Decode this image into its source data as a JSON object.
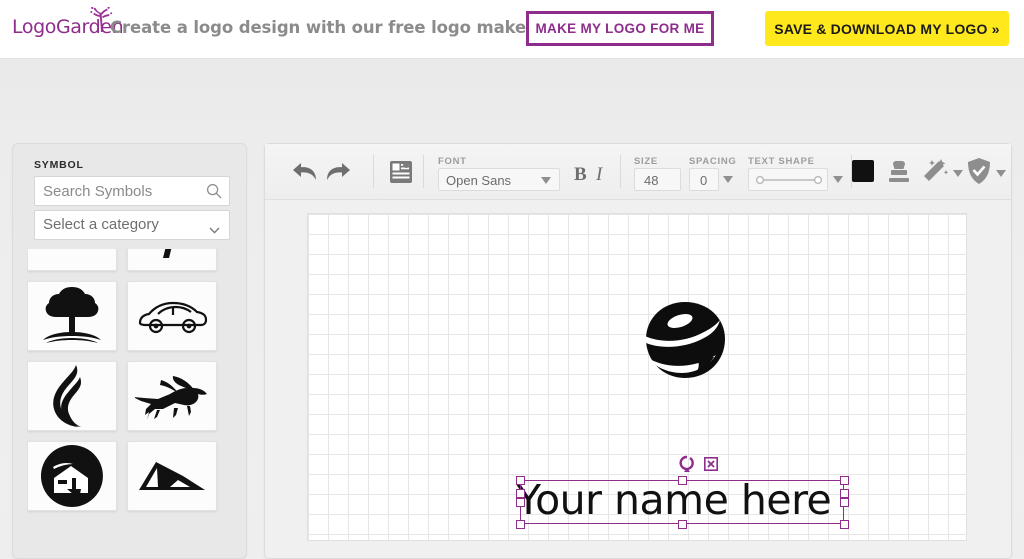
{
  "header": {
    "logo_text_left": "Logo",
    "logo_text_right": "Garden",
    "logo_icon": "plant-sprout-icon",
    "tagline": "Create a logo design with our free logo maker.",
    "make_logo_button": "MAKE MY LOGO FOR ME",
    "save_download_button": "SAVE & DOWNLOAD MY LOGO »",
    "accent_purple": "#8e2d8b",
    "accent_yellow": "#ffe81c"
  },
  "sidebar": {
    "title": "SYMBOL",
    "search": {
      "placeholder": "Search Symbols",
      "value": "",
      "icon": "search-icon"
    },
    "category": {
      "selected": "Select a category",
      "icon": "chevron-down-icon"
    },
    "symbols": [
      {
        "name": "sofa-symbol"
      },
      {
        "name": "lamp-post-symbol"
      },
      {
        "name": "tree-symbol"
      },
      {
        "name": "car-symbol"
      },
      {
        "name": "flame-symbol"
      },
      {
        "name": "pegasus-horse-symbol"
      },
      {
        "name": "house-circle-symbol"
      },
      {
        "name": "mountain-symbol"
      }
    ]
  },
  "toolbar": {
    "undo_label": "undo-icon",
    "redo_label": "redo-icon",
    "add_text_label": "add-text-icon",
    "font": {
      "label": "FONT",
      "value": "Open Sans"
    },
    "bold": {
      "label": "B"
    },
    "italic": {
      "label": "I"
    },
    "size": {
      "label": "SIZE",
      "value": "48"
    },
    "spacing": {
      "label": "SPACING",
      "value": "0"
    },
    "text_shape": {
      "label": "TEXT SHAPE",
      "value": ""
    },
    "color_swatch": {
      "name": "color-swatch",
      "value": "#111111"
    },
    "stamp_label": "stamp-icon",
    "effects_label": "magic-wand-icon",
    "protect_label": "shield-check-icon"
  },
  "canvas": {
    "logo_symbol": "sphere-swoosh-symbol",
    "logo_text": "Your name here",
    "selection_color": "#8e2d8b",
    "rotate_handle": "rotate-icon",
    "delete_handle": "delete-x-icon",
    "grid_size_px": "20"
  }
}
